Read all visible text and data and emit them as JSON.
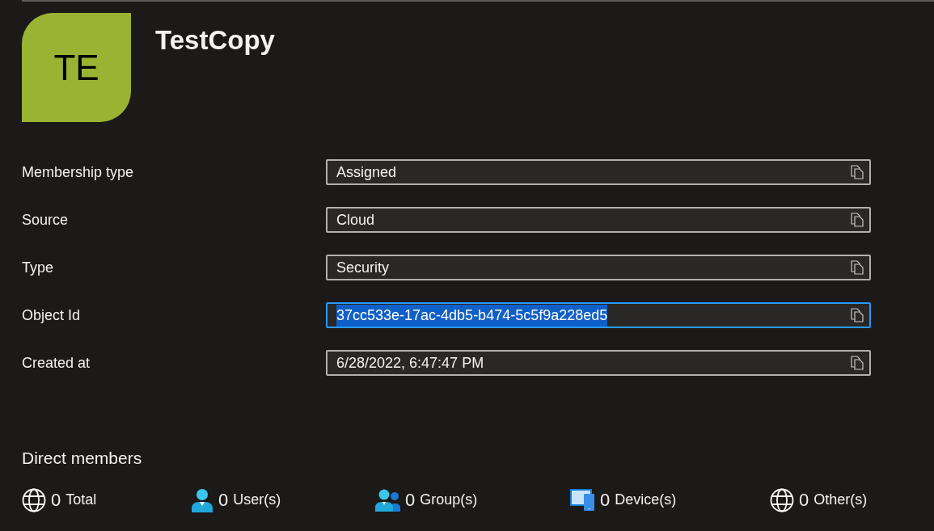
{
  "avatar": {
    "initials": "TE",
    "color": "#9bb332"
  },
  "title": "TestCopy",
  "properties": [
    {
      "label": "Membership type",
      "value": "Assigned",
      "focused": false
    },
    {
      "label": "Source",
      "value": "Cloud",
      "focused": false
    },
    {
      "label": "Type",
      "value": "Security",
      "focused": false
    },
    {
      "label": "Object Id",
      "value": "37cc533e-17ac-4db5-b474-5c5f9a228ed5",
      "focused": true
    },
    {
      "label": "Created at",
      "value": "6/28/2022, 6:47:47 PM",
      "focused": false
    }
  ],
  "direct_members": {
    "heading": "Direct members",
    "counts": [
      {
        "kind": "globe",
        "count": "0",
        "label": "Total"
      },
      {
        "kind": "user",
        "count": "0",
        "label": "User(s)"
      },
      {
        "kind": "group",
        "count": "0",
        "label": "Group(s)"
      },
      {
        "kind": "device",
        "count": "0",
        "label": "Device(s)"
      },
      {
        "kind": "globe",
        "count": "0",
        "label": "Other(s)"
      }
    ]
  }
}
